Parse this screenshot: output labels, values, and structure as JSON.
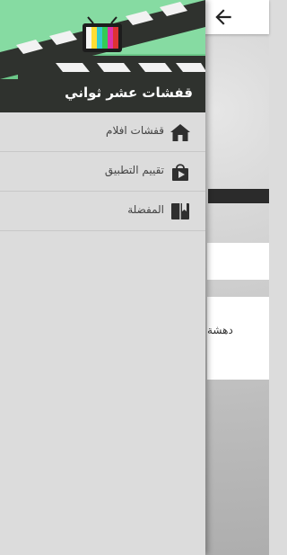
{
  "drawer": {
    "title": "قفشات عشر ثواني",
    "logo_text": "قفشات أفلام",
    "items": [
      {
        "label": "قفشات افلام",
        "icon": "home-icon"
      },
      {
        "label": "تقييم التطبيق",
        "icon": "store-bag-icon"
      },
      {
        "label": "المفضلة",
        "icon": "bookmark-book-icon"
      }
    ]
  },
  "background": {
    "card_text": "دهشة"
  },
  "colors": {
    "header_green": "#7fd39a",
    "drawer_bg": "#dcdcdc",
    "icon": "#2f2f2f"
  }
}
